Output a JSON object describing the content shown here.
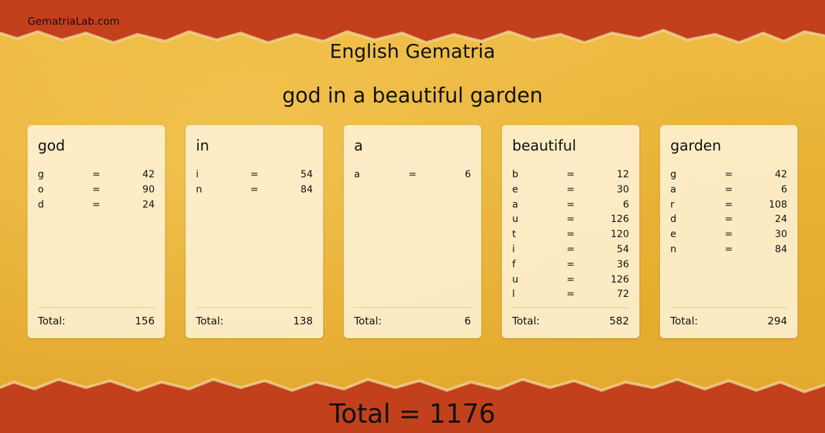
{
  "site": "GematriaLab.com",
  "title": "English Gematria",
  "phrase": "god in a beautiful garden",
  "colors": {
    "band": "#c2401c",
    "paper": "#e9b33a",
    "card": "#fdf1d8"
  },
  "cards": [
    {
      "word": "god",
      "letters": [
        {
          "l": "g",
          "v": "42"
        },
        {
          "l": "o",
          "v": "90"
        },
        {
          "l": "d",
          "v": "24"
        }
      ],
      "total_label": "Total:",
      "total": "156"
    },
    {
      "word": "in",
      "letters": [
        {
          "l": "i",
          "v": "54"
        },
        {
          "l": "n",
          "v": "84"
        }
      ],
      "total_label": "Total:",
      "total": "138"
    },
    {
      "word": "a",
      "letters": [
        {
          "l": "a",
          "v": "6"
        }
      ],
      "total_label": "Total:",
      "total": "6"
    },
    {
      "word": "beautiful",
      "letters": [
        {
          "l": "b",
          "v": "12"
        },
        {
          "l": "e",
          "v": "30"
        },
        {
          "l": "a",
          "v": "6"
        },
        {
          "l": "u",
          "v": "126"
        },
        {
          "l": "t",
          "v": "120"
        },
        {
          "l": "i",
          "v": "54"
        },
        {
          "l": "f",
          "v": "36"
        },
        {
          "l": "u",
          "v": "126"
        },
        {
          "l": "l",
          "v": "72"
        }
      ],
      "total_label": "Total:",
      "total": "582"
    },
    {
      "word": "garden",
      "letters": [
        {
          "l": "g",
          "v": "42"
        },
        {
          "l": "a",
          "v": "6"
        },
        {
          "l": "r",
          "v": "108"
        },
        {
          "l": "d",
          "v": "24"
        },
        {
          "l": "e",
          "v": "30"
        },
        {
          "l": "n",
          "v": "84"
        }
      ],
      "total_label": "Total:",
      "total": "294"
    }
  ],
  "equals_sign": "=",
  "grand_total": "Total = 1176"
}
